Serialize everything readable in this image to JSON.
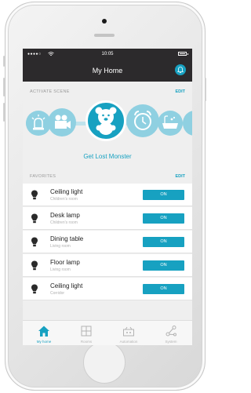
{
  "status_bar": {
    "signal": "●●●●○",
    "wifi": "wifi-icon",
    "time": "10:05",
    "battery": "battery-icon"
  },
  "header": {
    "title": "My Home",
    "bell_icon": "bell-icon"
  },
  "scenes": {
    "section_label": "ACTIVATE SCENE",
    "edit_label": "EDIT",
    "active_name": "Get Lost Monster",
    "items": [
      {
        "icon": "alarm-light-icon"
      },
      {
        "icon": "video-camera-icon"
      },
      {
        "icon": "teddy-bear-icon",
        "active": true
      },
      {
        "icon": "alarm-clock-icon"
      },
      {
        "icon": "bathtub-icon"
      }
    ]
  },
  "favorites": {
    "section_label": "FAVORITES",
    "edit_label": "EDIT",
    "items": [
      {
        "name": "Ceiling light",
        "room": "Children's room",
        "button": "ON"
      },
      {
        "name": "Desk lamp",
        "room": "Children's room",
        "button": "ON"
      },
      {
        "name": "Dining table",
        "room": "Living room",
        "button": "ON"
      },
      {
        "name": "Floor lamp",
        "room": "Living room",
        "button": "ON"
      },
      {
        "name": "Ceiling light",
        "room": "Corridor",
        "button": "ON"
      }
    ]
  },
  "tabs": [
    {
      "label": "My home",
      "icon": "home-icon",
      "active": true
    },
    {
      "label": "Rooms",
      "icon": "rooms-icon"
    },
    {
      "label": "Automation",
      "icon": "automation-icon"
    },
    {
      "label": "System",
      "icon": "system-icon"
    }
  ],
  "colors": {
    "accent": "#17a1c1",
    "scene_light": "#8fd0e1",
    "dark_bar": "#2c2a2c"
  }
}
